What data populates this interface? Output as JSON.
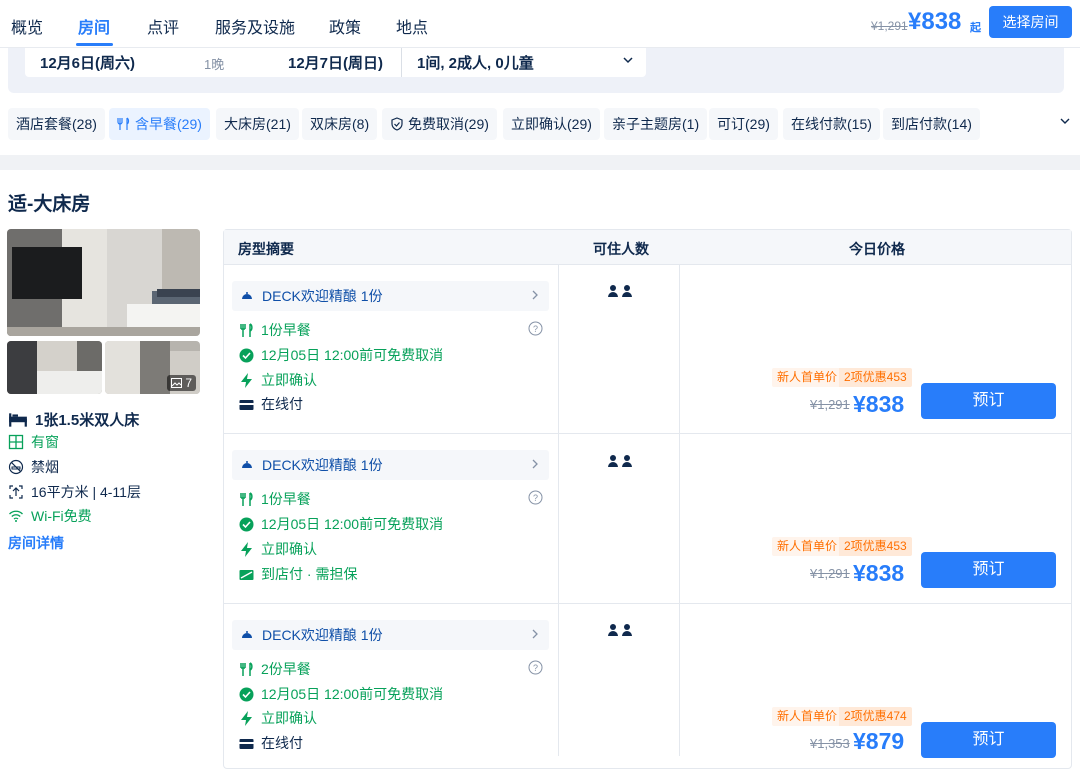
{
  "nav": {
    "tabs": [
      {
        "label": "概览"
      },
      {
        "label": "房间"
      },
      {
        "label": "点评"
      },
      {
        "label": "服务及设施"
      },
      {
        "label": "政策"
      },
      {
        "label": "地点"
      }
    ],
    "old_price": "¥1,291",
    "price": "¥838",
    "price_suffix": "起",
    "select_room": "选择房间"
  },
  "search": {
    "checkin": "12月6日(周六)",
    "nights": "1晚",
    "checkout": "12月7日(周日)",
    "guests": "1间, 2成人, 0儿童"
  },
  "filters": [
    {
      "label": "酒店套餐(28)",
      "icon": ""
    },
    {
      "label": "含早餐(29)",
      "icon": "breakfast-icon",
      "active": true
    },
    {
      "label": "大床房(21)",
      "icon": ""
    },
    {
      "label": "双床房(8)",
      "icon": ""
    },
    {
      "label": "免费取消(29)",
      "icon": "shield-check-icon"
    },
    {
      "label": "立即确认(29)",
      "icon": ""
    },
    {
      "label": "亲子主题房(1)",
      "icon": ""
    },
    {
      "label": "可订(29)",
      "icon": ""
    },
    {
      "label": "在线付款(15)",
      "icon": ""
    },
    {
      "label": "到店付款(14)",
      "icon": ""
    }
  ],
  "room": {
    "title": "适-大床房",
    "photo_count": "7",
    "bed": "1张1.5米双人床",
    "window": "有窗",
    "smoking": "禁烟",
    "area": "16平方米 | 4-11层",
    "wifi": "Wi-Fi免费",
    "detail_link": "房间详情"
  },
  "table": {
    "headers": {
      "summary": "房型摘要",
      "occupancy": "可住人数",
      "price": "今日价格"
    },
    "rows": [
      {
        "package": "DECK欢迎精酿 1份",
        "breakfast": "1份早餐",
        "cancel": "12月05日 12:00前可免费取消",
        "confirm": "立即确认",
        "payment": "在线付",
        "payment_icon": "card-icon",
        "new_tag": "新人首单价",
        "discount_tag": "2项优惠453",
        "old_price": "¥1,291",
        "price": "¥838",
        "book": "预订"
      },
      {
        "package": "DECK欢迎精酿 1份",
        "breakfast": "1份早餐",
        "cancel": "12月05日 12:00前可免费取消",
        "confirm": "立即确认",
        "payment": "到店付 · 需担保",
        "payment_icon": "pay-at-hotel-icon",
        "new_tag": "新人首单价",
        "discount_tag": "2项优惠453",
        "old_price": "¥1,291",
        "price": "¥838",
        "book": "预订"
      },
      {
        "package": "DECK欢迎精酿 1份",
        "breakfast": "2份早餐",
        "cancel": "12月05日 12:00前可免费取消",
        "confirm": "立即确认",
        "payment": "在线付",
        "payment_icon": "card-icon",
        "new_tag": "新人首单价",
        "discount_tag": "2项优惠474",
        "old_price": "¥1,353",
        "price": "¥879",
        "book": "预订"
      }
    ]
  },
  "colors": {
    "accent": "#287dfa",
    "green": "#07a15a",
    "orange": "#ff6f00",
    "text": "#0f294d"
  }
}
